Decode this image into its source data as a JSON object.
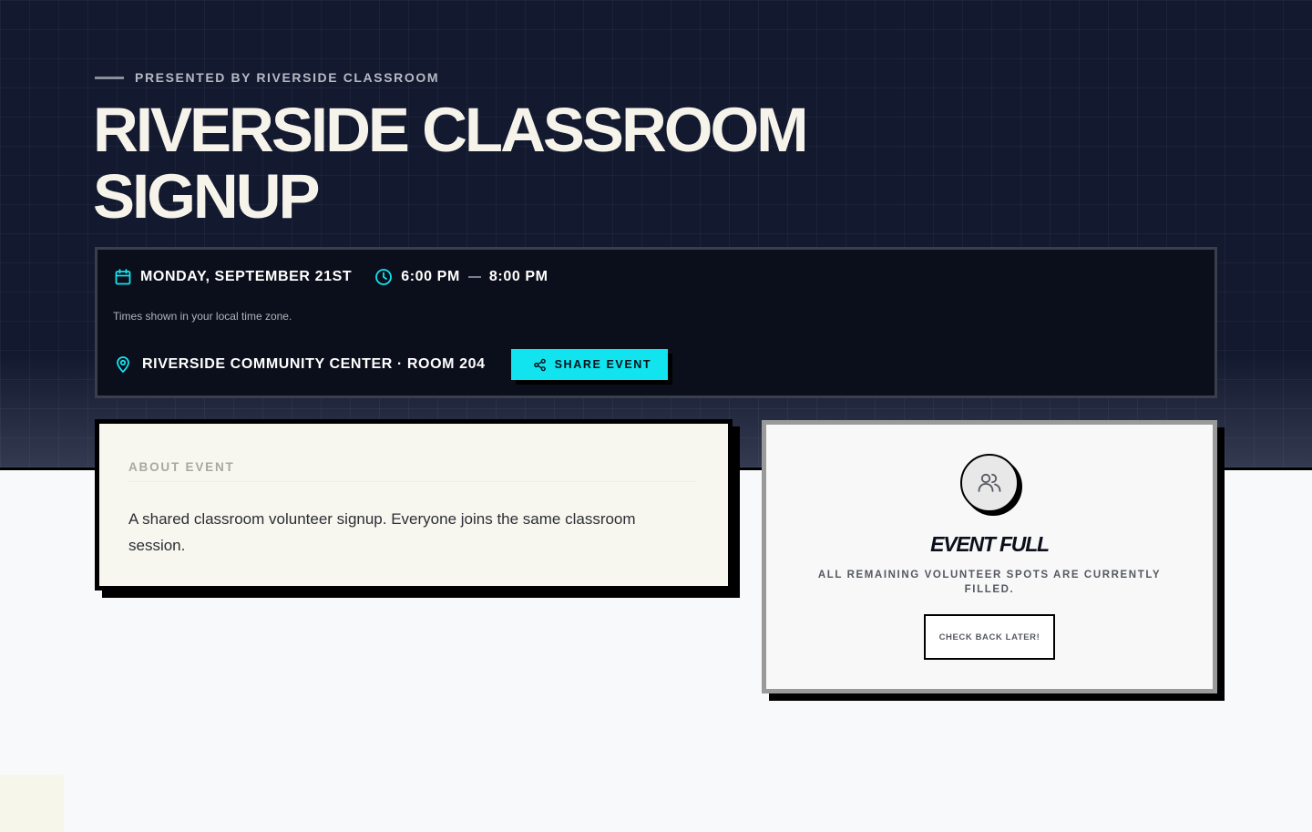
{
  "hero": {
    "eyebrow": "PRESENTED BY RIVERSIDE CLASSROOM",
    "title_line1": "RIVERSIDE CLASSROOM",
    "title_line2": "SIGNUP"
  },
  "event_info": {
    "date": "MONDAY, SEPTEMBER 21ST",
    "time_start": "6:00 PM",
    "time_end": "8:00 PM",
    "timezone_note": "Times shown in your local time zone.",
    "location": "RIVERSIDE COMMUNITY CENTER · ROOM 204",
    "share_label": "SHARE EVENT",
    "icons": {
      "date": "calendar-icon",
      "time": "clock-icon",
      "location": "map-pin-icon",
      "share": "share-icon"
    }
  },
  "about": {
    "heading": "ABOUT EVENT",
    "body": "A shared classroom volunteer signup. Everyone joins the same classroom session."
  },
  "status": {
    "icon": "users-icon",
    "title": "EVENT FULL",
    "subtitle": "ALL REMAINING VOLUNTEER SPOTS ARE CURRENTLY FILLED.",
    "button_label": "CHECK BACK LATER!"
  },
  "colors": {
    "hero_bg": "#131a30",
    "accent_cyan": "#12e4ef",
    "title_cream": "#f6f3ea",
    "card_cream": "#f8f7ef"
  }
}
